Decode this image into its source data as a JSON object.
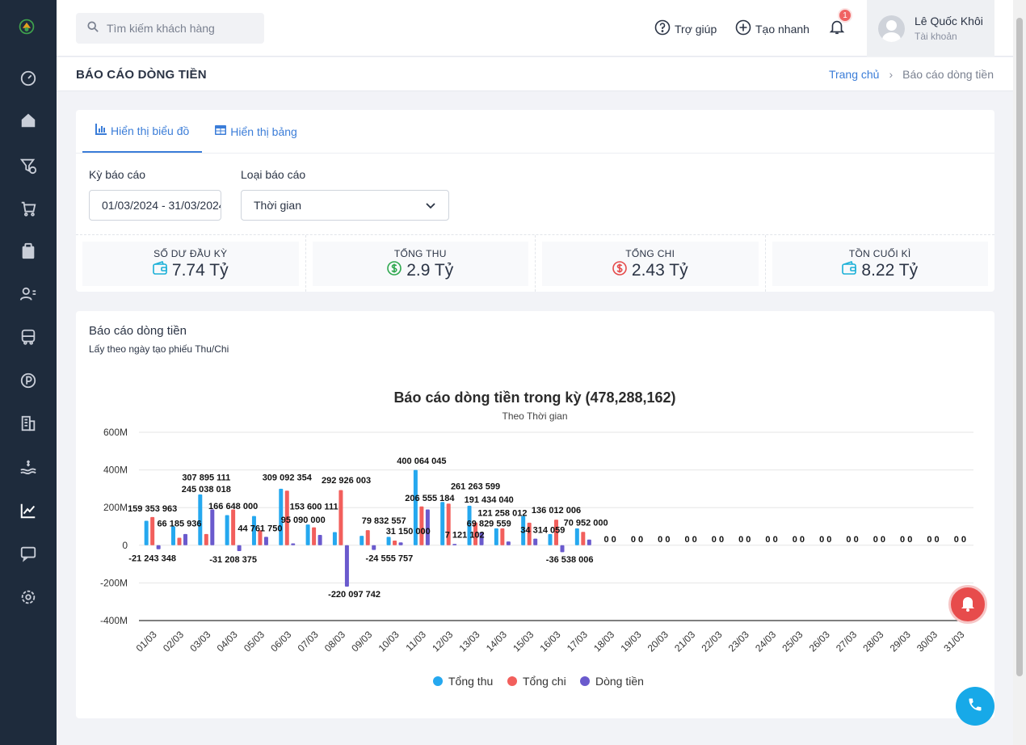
{
  "search": {
    "placeholder": "Tìm kiếm khách hàng"
  },
  "header": {
    "help": "Trợ giúp",
    "quick_create": "Tạo nhanh",
    "notification_count": "1",
    "user_name": "Lê Quốc Khôi",
    "user_role": "Tài khoản"
  },
  "page": {
    "title": "BÁO CÁO DÒNG TIỀN",
    "breadcrumb_home": "Trang chủ",
    "breadcrumb_sep": "›",
    "breadcrumb_current": "Báo cáo dòng tiền"
  },
  "tabs": [
    {
      "label": "Hiển thị biểu đồ"
    },
    {
      "label": "Hiển thị bảng"
    }
  ],
  "filters": {
    "period_label": "Kỳ báo cáo",
    "period_value": "01/03/2024 - 31/03/2024",
    "type_label": "Loại báo cáo",
    "type_value": "Thời gian"
  },
  "stats": [
    {
      "label": "SỐ DƯ ĐẦU KỲ",
      "value": "7.74 Tỷ",
      "icon": "wallet-icon",
      "color": "#1ab0d8"
    },
    {
      "label": "TỔNG THU",
      "value": "2.9 Tỷ",
      "icon": "dollar-circle-icon",
      "color": "#2fa84f"
    },
    {
      "label": "TỔNG CHI",
      "value": "2.43 Tỷ",
      "icon": "dollar-circle-icon",
      "color": "#e54b4b"
    },
    {
      "label": "TỒN CUỐI KÌ",
      "value": "8.22 Tỷ",
      "icon": "wallet-icon",
      "color": "#1ab0d8"
    }
  ],
  "report": {
    "title": "Báo cáo dòng tiền",
    "subtitle": "Lấy theo ngày tạo phiếu Thu/Chi"
  },
  "colors": {
    "income": "#25a8ef",
    "expense": "#f25f5c",
    "cashflow": "#6a5acd",
    "accent": "#3b7dd8"
  },
  "chart_data": {
    "type": "bar",
    "title": "Báo cáo dòng tiền trong kỳ (478,288,162)",
    "subtitle": "Theo Thời gian",
    "categories": [
      "01/03",
      "02/03",
      "03/03",
      "04/03",
      "05/03",
      "06/03",
      "07/03",
      "08/03",
      "09/03",
      "10/03",
      "11/03",
      "12/03",
      "13/03",
      "14/03",
      "15/03",
      "16/03",
      "17/03",
      "18/03",
      "19/03",
      "20/03",
      "21/03",
      "22/03",
      "23/03",
      "24/03",
      "25/03",
      "26/03",
      "27/03",
      "28/03",
      "29/03",
      "30/03",
      "31/03"
    ],
    "ylim": [
      -400,
      600
    ],
    "yticks": [
      "600M",
      "400M",
      "200M",
      "0",
      "-200M",
      "-400M"
    ],
    "series": [
      {
        "name": "Tổng thu",
        "values": [
          130,
          100,
          270,
          160,
          155,
          300,
          110,
          70,
          50,
          45,
          400,
          230,
          210,
          90,
          155,
          60,
          90,
          0,
          0,
          0,
          0,
          0,
          0,
          0,
          0,
          0,
          0,
          0,
          0,
          0,
          0
        ]
      },
      {
        "name": "Tổng chi",
        "values": [
          150,
          40,
          60,
          190,
          80,
          290,
          95,
          293,
          80,
          25,
          206,
          221,
          121,
          90,
          120,
          136,
          71,
          0,
          0,
          0,
          0,
          0,
          0,
          0,
          0,
          0,
          0,
          0,
          0,
          0,
          0
        ]
      },
      {
        "name": "Dòng tiền",
        "values": [
          -21,
          60,
          190,
          -31,
          45,
          10,
          55,
          -220,
          -25,
          15,
          190,
          7,
          70,
          20,
          35,
          -37,
          30,
          0,
          0,
          0,
          0,
          0,
          0,
          0,
          0,
          0,
          0,
          0,
          0,
          0,
          0
        ]
      }
    ],
    "data_labels": [
      {
        "text": "159 353 963",
        "day": 0,
        "value": 180
      },
      {
        "text": "-21 243 348",
        "day": 0,
        "value": -85
      },
      {
        "text": "66 185 936",
        "day": 1,
        "value": 100
      },
      {
        "text": "307 895 111",
        "day": 2,
        "value": 345
      },
      {
        "text": "245 038 018",
        "day": 2,
        "value": 282
      },
      {
        "text": "166 648 000",
        "day": 3,
        "value": 192
      },
      {
        "text": "-31 208 375",
        "day": 3,
        "value": -90
      },
      {
        "text": "44 761 750",
        "day": 4,
        "value": 75
      },
      {
        "text": "309 092 354",
        "day": 5,
        "value": 345
      },
      {
        "text": "153 600 111",
        "day": 6,
        "value": 190
      },
      {
        "text": "95 090 000",
        "day": 5.6,
        "value": 120
      },
      {
        "text": "292 926 003",
        "day": 7.2,
        "value": 330
      },
      {
        "text": "-220 097 742",
        "day": 7.5,
        "value": -275
      },
      {
        "text": "79 832 557",
        "day": 8.6,
        "value": 115
      },
      {
        "text": "31 150 000",
        "day": 9.5,
        "value": 60
      },
      {
        "text": "-24 555 757",
        "day": 8.8,
        "value": -85
      },
      {
        "text": "400 064 045",
        "day": 10,
        "value": 433
      },
      {
        "text": "206 555 184",
        "day": 10.3,
        "value": 235
      },
      {
        "text": "261 263 599",
        "day": 12,
        "value": 297
      },
      {
        "text": "191 434 040",
        "day": 12.5,
        "value": 227
      },
      {
        "text": "121 258 012",
        "day": 13,
        "value": 155
      },
      {
        "text": "7 121 102",
        "day": 11.6,
        "value": 40
      },
      {
        "text": "69 829 559",
        "day": 12.5,
        "value": 100
      },
      {
        "text": "136 012 006",
        "day": 15,
        "value": 170
      },
      {
        "text": "34 314 059",
        "day": 14.5,
        "value": 65
      },
      {
        "text": "70 952 000",
        "day": 16.1,
        "value": 105
      },
      {
        "text": "-36 538 006",
        "day": 15.5,
        "value": -90
      }
    ],
    "legend": [
      "Tổng thu",
      "Tổng chi",
      "Dòng tiền"
    ],
    "legend_position": "bottom",
    "grid": true
  }
}
